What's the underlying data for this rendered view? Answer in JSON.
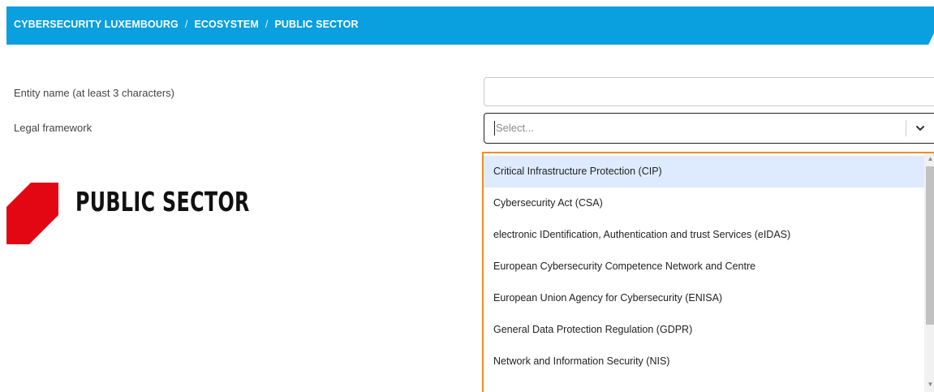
{
  "breadcrumb": {
    "items": [
      "CYBERSECURITY LUXEMBOURG",
      "ECOSYSTEM",
      "PUBLIC SECTOR"
    ],
    "separator": "/"
  },
  "form": {
    "entity_name_label": "Entity name (at least 3 characters)",
    "entity_name_value": "",
    "legal_framework_label": "Legal framework",
    "legal_framework_placeholder": "Select..."
  },
  "logo": {
    "text": "PUBLIC SECTOR",
    "color": "#e30613"
  },
  "dropdown": {
    "focused_index": 0,
    "options": [
      "Critical Infrastructure Protection (CIP)",
      "Cybersecurity Act (CSA)",
      "electronic IDentification, Authentication and trust Services (eIDAS)",
      "European Cybersecurity Competence Network and Centre",
      "European Union Agency for Cybersecurity (ENISA)",
      "General Data Protection Regulation (GDPR)",
      "Network and Information Security (NIS)"
    ]
  },
  "colors": {
    "banner": "#0a9fde",
    "menu_border": "#f28c28",
    "focused_option": "#deebff"
  }
}
